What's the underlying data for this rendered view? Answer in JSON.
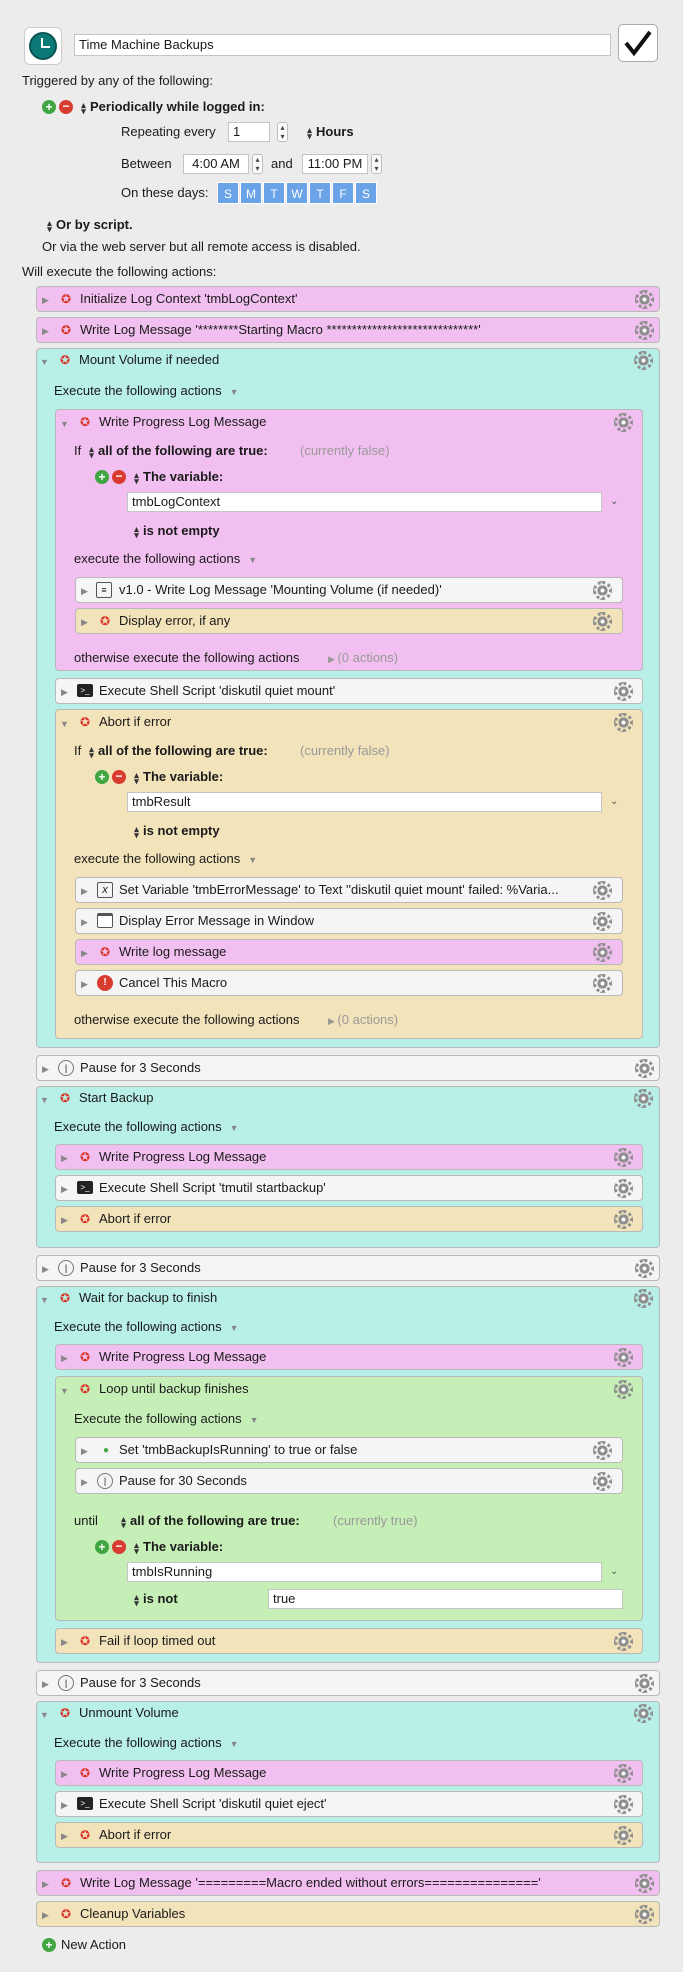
{
  "macro": {
    "name": "Time Machine Backups",
    "enabled_icon": "checkmark-icon",
    "app_icon": "time-machine-icon"
  },
  "trigger": {
    "heading": "Triggered by any of the following:",
    "periodic_label": "Periodically while logged in:",
    "repeating_label": "Repeating every",
    "repeating_value": "1",
    "unit": "Hours",
    "between_label": "Between",
    "start_time": "4:00 AM",
    "and_label": "and",
    "end_time": "11:00 PM",
    "days_label": "On these days:",
    "days": [
      "S",
      "M",
      "T",
      "W",
      "T",
      "F",
      "S"
    ],
    "script_label": "Or by script.",
    "web_label": "Or via the web server but all remote access is disabled."
  },
  "will_execute": "Will execute the following actions:",
  "a": {
    "init_log": "Initialize Log Context 'tmbLogContext'",
    "write_log": "Write Log Message '********Starting Macro ******************************'",
    "mount": "Mount Volume if needed",
    "exec_actions": "Execute the following actions",
    "write_progress": "Write Progress Log Message",
    "if": "If",
    "all_true": "all of the following are true:",
    "currently_false": "(currently false)",
    "currently_true": "(currently true)",
    "the_variable": "The variable:",
    "var1": "tmbLogContext",
    "is_not_empty": "is not empty",
    "execute_following": "execute the following actions",
    "v1_write": "v1.0 - Write Log Message 'Mounting Volume (if needed)'",
    "display_error": "Display error, if any",
    "otherwise": "otherwise execute the following actions",
    "zero_actions": "(0 actions)",
    "shell_mount": "Execute Shell Script 'diskutil quiet mount'",
    "abort": "Abort if error",
    "var2": "tmbResult",
    "set_var": "Set Variable 'tmbErrorMessage' to Text ''diskutil quiet mount' failed: %Varia...",
    "display_window": "Display Error Message in Window",
    "write_log_msg": "Write log message",
    "cancel": "Cancel This Macro",
    "pause3": "Pause for 3 Seconds",
    "start_backup": "Start Backup",
    "shell_tmutil": "Execute Shell Script 'tmutil startbackup'",
    "wait": "Wait for backup to finish",
    "loop": "Loop until backup finishes",
    "set_running": "Set 'tmbBackupIsRunning' to true or false",
    "pause30": "Pause for 30 Seconds",
    "until": "until",
    "var3": "tmbIsRunning",
    "is_not": "is not",
    "true_val": "true",
    "fail_loop": "Fail if loop timed out",
    "unmount": "Unmount Volume",
    "shell_eject": "Execute Shell Script 'diskutil quiet eject'",
    "ended": "Write Log Message '=========Macro ended without errors==============='",
    "cleanup": "Cleanup Variables"
  },
  "new_action": "New Action",
  "colors": {
    "pink": "#f2c0f0",
    "teal": "#b8efe6",
    "tan": "#f3e3bb",
    "green": "#c6eeb7",
    "day": "#6aa3e8"
  }
}
